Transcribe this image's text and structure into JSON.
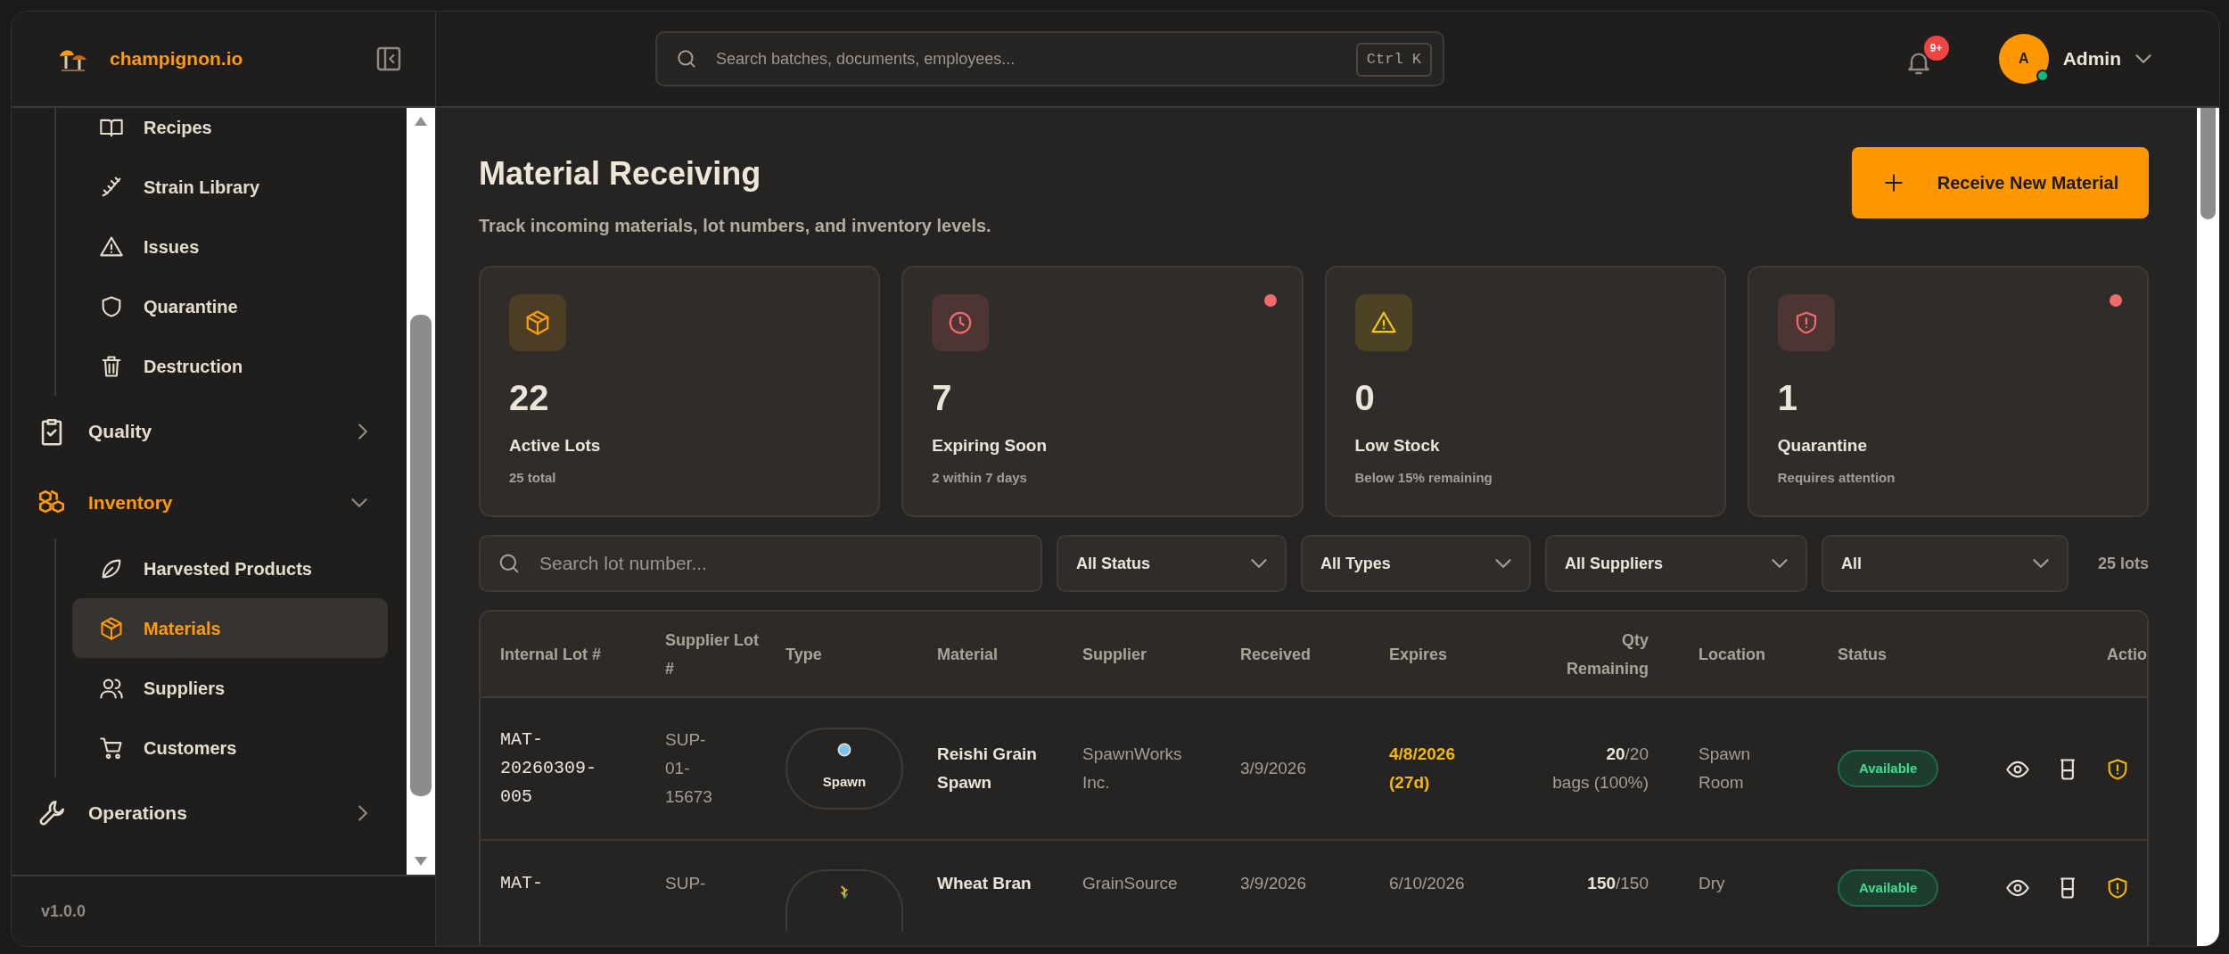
{
  "brand": {
    "name": "champignon.io"
  },
  "sidebar": {
    "items": [
      {
        "kind": "sub",
        "label": "Recipes",
        "selected": false
      },
      {
        "kind": "sub",
        "label": "Strain Library",
        "selected": false
      },
      {
        "kind": "sub",
        "label": "Issues",
        "selected": false
      },
      {
        "kind": "sub",
        "label": "Quarantine",
        "selected": false
      },
      {
        "kind": "sub",
        "label": "Destruction",
        "selected": false
      },
      {
        "kind": "group",
        "label": "Quality",
        "expanded": false,
        "selected": false
      },
      {
        "kind": "group",
        "label": "Inventory",
        "expanded": true,
        "selected": true,
        "children": [
          {
            "label": "Harvested Products",
            "selected": false
          },
          {
            "label": "Materials",
            "selected": true
          },
          {
            "label": "Suppliers",
            "selected": false
          },
          {
            "label": "Customers",
            "selected": false
          }
        ]
      },
      {
        "kind": "group",
        "label": "Operations",
        "expanded": false,
        "selected": false
      }
    ],
    "version": "v1.0.0"
  },
  "topbar": {
    "search": {
      "placeholder": "Search batches, documents, employees...",
      "shortcut": "Ctrl K"
    },
    "notifications": "9+",
    "user": {
      "initial": "A",
      "name": "Admin",
      "online": true
    }
  },
  "page": {
    "title": "Material Receiving",
    "subtitle": "Track incoming materials, lot numbers, and inventory levels.",
    "primary_button": "Receive New Material"
  },
  "stats": [
    {
      "value": "22",
      "label": "Active Lots",
      "note": "25 total",
      "color": "#f59e0b",
      "alert": false
    },
    {
      "value": "7",
      "label": "Expiring Soon",
      "note": "2 within 7 days",
      "color": "#f06b6b",
      "alert": true
    },
    {
      "value": "0",
      "label": "Low Stock",
      "note": "Below 15% remaining",
      "color": "#f5c518",
      "alert": false
    },
    {
      "value": "1",
      "label": "Quarantine",
      "note": "Requires attention",
      "color": "#f06b6b",
      "alert": true
    }
  ],
  "filters": {
    "search": {
      "placeholder": "Search lot number..."
    },
    "selects": [
      "All Status",
      "All Types",
      "All Suppliers",
      "All"
    ],
    "count": "25 lots"
  },
  "table": {
    "columns": [
      "Internal Lot #",
      "Supplier Lot #",
      "Type",
      "Material",
      "Supplier",
      "Received",
      "Expires",
      "Qty Remaining",
      "Location",
      "Status",
      "Actio"
    ],
    "rows": [
      {
        "internal_lot": "MAT-20260309-005",
        "supplier_lot": "SUP-01-15673",
        "type": {
          "kind": "spawn",
          "label": "Spawn"
        },
        "material": "Reishi Grain Spawn",
        "supplier": "SpawnWorks Inc.",
        "received": "3/9/2026",
        "expires": "4/8/2026 (27d)",
        "expiring": true,
        "qty": "**20**/20",
        "qty_unit": "bags (100%)",
        "location": "Spawn Room",
        "status": {
          "kind": "available",
          "label": "Available"
        }
      },
      {
        "internal_lot": "MAT-",
        "supplier_lot": "SUP-",
        "type": {
          "kind": "grain"
        },
        "material": "Wheat Bran",
        "supplier": "GrainSource",
        "received": "3/9/2026",
        "expires": "6/10/2026",
        "expiring": false,
        "qty": "**150**/150",
        "location": "Dry",
        "status": {
          "kind": "available",
          "label": "Available"
        }
      }
    ]
  }
}
